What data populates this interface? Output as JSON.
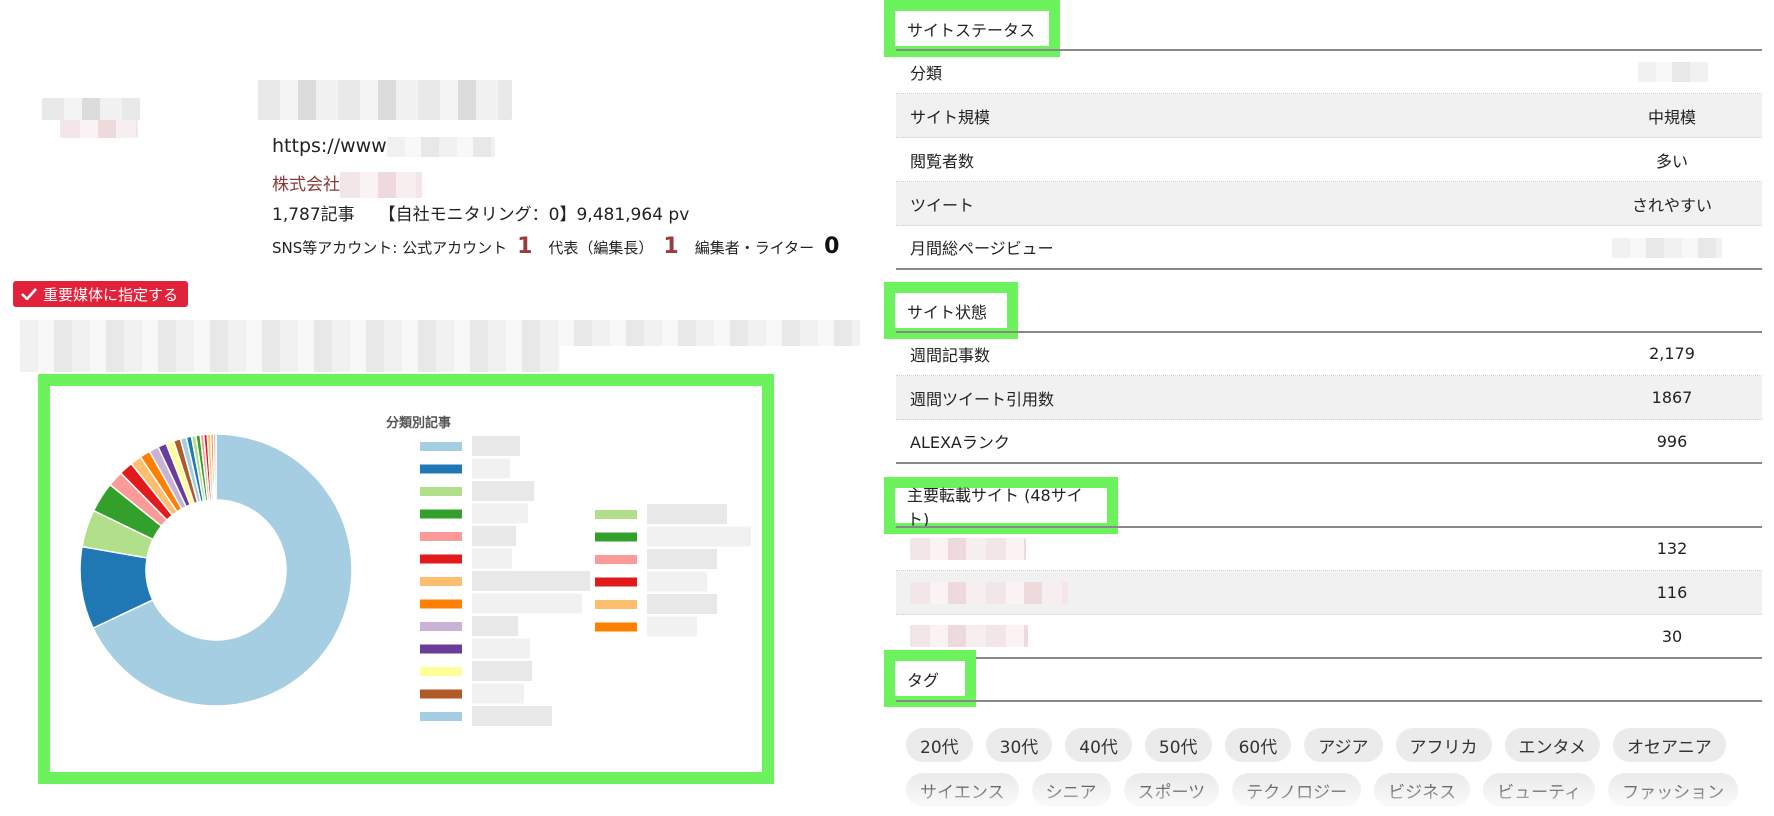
{
  "site": {
    "url_prefix": "https://www",
    "company_prefix": "株式会社",
    "articles": "1,787記事",
    "monitoring_pv": "【自社モニタリング：0】9,481,964 pv",
    "sns_label": "SNS等アカウント: 公式アカウント",
    "official_count": "1",
    "editor_label": "代表（編集長）",
    "editor_count": "1",
    "writer_label": "編集者・ライター",
    "writer_count": "0",
    "important_button": "重要媒体に指定する"
  },
  "colors": {
    "highlight": "#6bf25d",
    "important": "#e0223a"
  },
  "chart_data": {
    "type": "pie",
    "title": "分類別記事",
    "donut": true,
    "values": [
      66,
      9.5,
      4.3,
      3.5,
      1.8,
      1.6,
      1.3,
      1.2,
      1.1,
      1.0,
      0.9,
      0.8,
      0.7,
      0.6,
      0.5,
      0.5,
      0.4,
      0.4,
      0.4,
      0.3,
      0.3
    ],
    "colors": [
      "#a6cee3",
      "#1f78b4",
      "#b2df8a",
      "#33a02c",
      "#fb9a99",
      "#e31a1c",
      "#fdbf6f",
      "#ff7f00",
      "#cab2d6",
      "#6a3d9a",
      "#ffff99",
      "#b15928",
      "#a6cee3",
      "#1f78b4",
      "#b2df8a",
      "#33a02c",
      "#fb9a99",
      "#e31a1c",
      "#fdbf6f",
      "#ff7f00",
      "#cab2d6"
    ],
    "legend_colors_col1": [
      "#a6cee3",
      "#1f78b4",
      "#b2df8a",
      "#33a02c",
      "#fb9a99",
      "#e31a1c",
      "#fdbf6f",
      "#ff7f00",
      "#cab2d6",
      "#6a3d9a",
      "#ffff99",
      "#b15928",
      "#a6cee3"
    ],
    "legend_colors_col2": [
      "#b2df8a",
      "#33a02c",
      "#fb9a99",
      "#e31a1c",
      "#fdbf6f",
      "#ff7f00"
    ]
  },
  "status": {
    "tab": "サイトステータス",
    "rows": [
      {
        "label": "分類",
        "value": ""
      },
      {
        "label": "サイト規模",
        "value": "中規模"
      },
      {
        "label": "閲覧者数",
        "value": "多い"
      },
      {
        "label": "ツイート",
        "value": "されやすい"
      },
      {
        "label": "月間総ページビュー",
        "value": ""
      }
    ]
  },
  "state": {
    "tab": "サイト状態",
    "rows": [
      {
        "label": "週間記事数",
        "value": "2,179"
      },
      {
        "label": "週間ツイート引用数",
        "value": "1867"
      },
      {
        "label": "ALEXAランク",
        "value": "996"
      }
    ]
  },
  "syndication": {
    "tab": "主要転載サイト (48サイト)",
    "rows": [
      {
        "value": "132"
      },
      {
        "value": "116"
      },
      {
        "value": "30"
      }
    ]
  },
  "tags": {
    "tab": "タグ",
    "items": [
      "20代",
      "30代",
      "40代",
      "50代",
      "60代",
      "アジア",
      "アフリカ",
      "エンタメ",
      "オセアニア",
      "サイエンス",
      "シニア",
      "スポーツ",
      "テクノロジー",
      "ビジネス",
      "ビューティ",
      "ファッション"
    ]
  }
}
